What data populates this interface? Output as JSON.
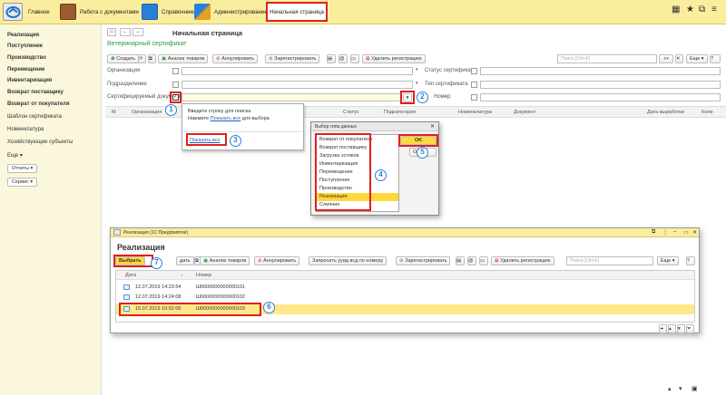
{
  "topbar": {
    "sections": [
      "Главное",
      "Работа с документами",
      "Справочники",
      "Администрирование",
      "Начальная страница"
    ]
  },
  "sidebar": {
    "bold_items": [
      "Реализация",
      "Поступление",
      "Производство",
      "Перемещение",
      "Инвентаризация",
      "Возврат поставщику",
      "Возврат от покупателя"
    ],
    "items": [
      "Шаблон сертификата",
      "Номенклатура",
      "Хозяйствующие субъекты",
      "Еще"
    ],
    "buttons": [
      "Отчеты",
      "Сервис"
    ]
  },
  "main": {
    "page_title": "Начальная страница",
    "form_title": "Ветеринарный сертификат",
    "toolbar": {
      "create": "Создать",
      "analysis": "Анализ товаров",
      "cancel": "Аннулировать",
      "register": "Зарегистрировать",
      "delete_reg": "Удалить регистрацию",
      "more": "Еще"
    },
    "search_placeholder": "Поиск (Ctrl+F)",
    "filters": {
      "org": "Организация",
      "dept": "Подразделение",
      "certified_doc": "Сертифицируемый документ",
      "cert_status": "Статус сертификата",
      "cert_type": "Тип сертификата",
      "number": "Номер"
    },
    "columns": [
      "М",
      "Организация",
      "Статус",
      "Подкатегория",
      "Номенклатура",
      "Документ",
      "Дата выработки",
      "Коли"
    ]
  },
  "popup": {
    "line1": "Введите строку для поиска",
    "line2_prefix": "Нажмите ",
    "line2_link": "Показать все",
    "line2_suffix": " для выбора",
    "show_all": "Показать все"
  },
  "type_dialog": {
    "title": "Выбор типа данных",
    "items": [
      "Возврат от покупателя",
      "Возврат поставщику",
      "Загрузка эстиков",
      "Инвентаризация",
      "Перемещение",
      "Поступление",
      "Производство",
      "Реализация",
      "Слияние"
    ],
    "ok": "OK",
    "cancel": "Отм"
  },
  "list_window": {
    "title": "Реализация  (1С:Предприятие)",
    "heading": "Реализация",
    "toolbar": {
      "select": "Выбрать",
      "create": "дать",
      "analysis": "Анализ товаров",
      "cancel": "Аннулировать",
      "request_uuid": "Запросить ууид всд по номеру",
      "register": "Зарегистрировать",
      "delete_reg": "Удалить регистрацию",
      "more": "Еще"
    },
    "search_placeholder": "Поиск (Ctrl+F)",
    "columns": {
      "date": "Дата",
      "number": "Номер"
    },
    "rows": [
      {
        "date": "12.07.2019 14:23:54",
        "number": "Ш0000000000000101"
      },
      {
        "date": "12.07.2019 14:24:08",
        "number": "Ш0000000000000102"
      },
      {
        "date": "15.07.2019 10:52:06",
        "number": "Ш0000000000000103"
      }
    ]
  },
  "markers": [
    "1",
    "2",
    "3",
    "4",
    "5",
    "6",
    "7"
  ],
  "colors": {
    "accent": "#e02020",
    "marker": "#2a7fd8",
    "topbar": "#fbed9e",
    "selected": "#ffd83d",
    "green_title": "#2e9a3a"
  }
}
